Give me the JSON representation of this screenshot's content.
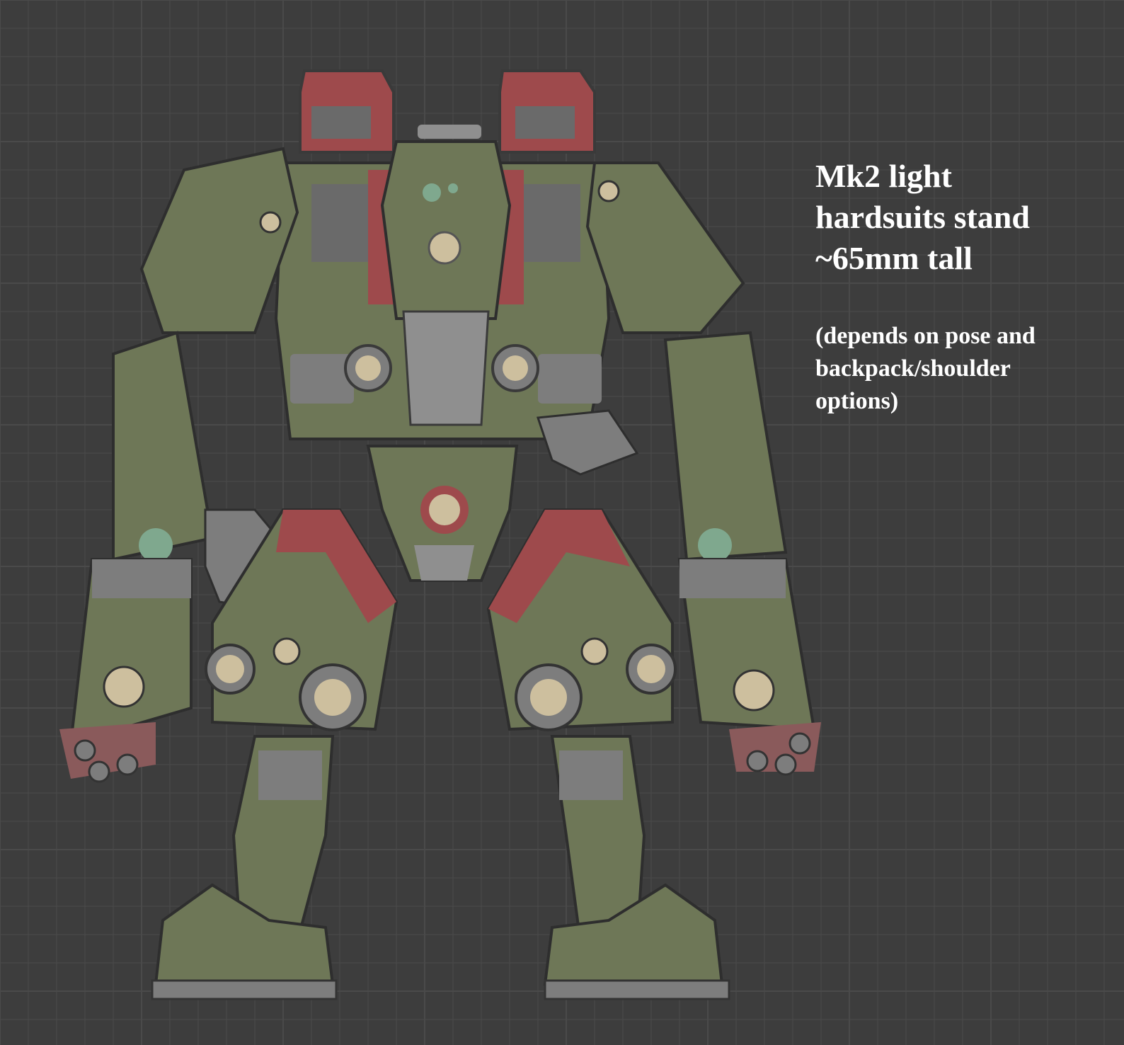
{
  "caption": {
    "title_lines": [
      "Mk2 light",
      "hardsuits stand",
      "~65mm tall"
    ],
    "note_lines": [
      "(depends on pose and",
      "backpack/shoulder",
      "options)"
    ]
  },
  "colors": {
    "background": "#3d3d3d",
    "grid": "#4a4a4a",
    "armor_green": "#6e7757",
    "armor_green_dark": "#5b6347",
    "mech_red": "#9e4a4c",
    "mech_grey": "#7d7d7d",
    "joint_beige": "#cdbf9e",
    "lens_teal": "#7fa88e",
    "caption_text": "#ffffff"
  }
}
